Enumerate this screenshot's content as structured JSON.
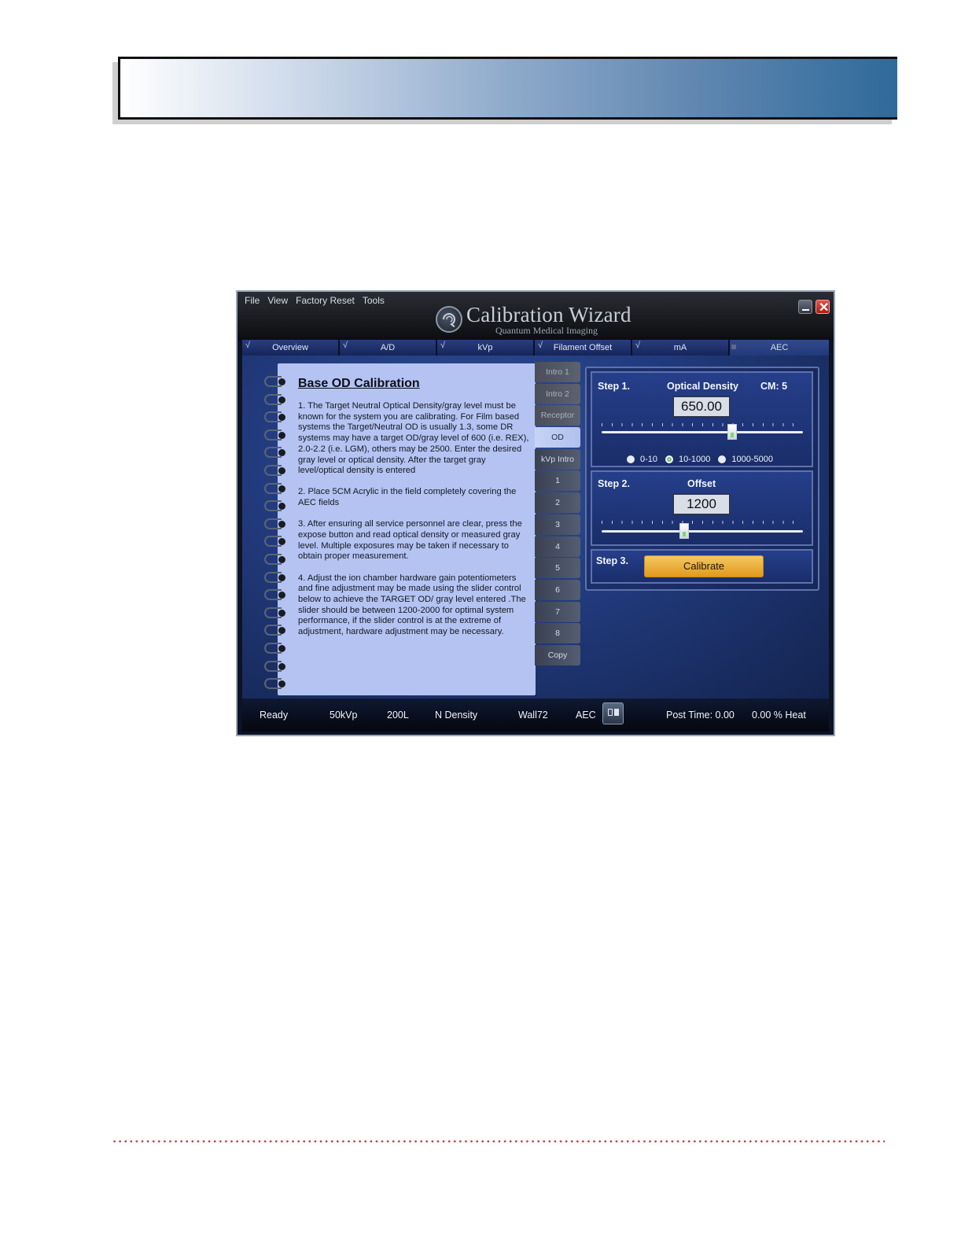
{
  "app": {
    "menu": [
      "File",
      "View",
      "Factory Reset",
      "Tools"
    ],
    "title": "Calibration Wizard",
    "subtitle": "Quantum Medical Imaging",
    "close_glyph": "✕"
  },
  "tabs": [
    {
      "label": "Overview",
      "checked": true
    },
    {
      "label": "A/D",
      "checked": true
    },
    {
      "label": "kVp",
      "checked": true
    },
    {
      "label": "Filament Offset",
      "checked": true
    },
    {
      "label": "mA",
      "checked": true
    },
    {
      "label": "AEC",
      "checked": false,
      "active": true
    }
  ],
  "check_glyph": "√",
  "notebook": {
    "title": "Base OD Calibration",
    "paragraphs": [
      "1. The Target Neutral Optical Density/gray level must be known for the system you are calibrating. For Film based systems the Target/Neutral OD is usually 1.3, some DR systems may have a target OD/gray level of 600 (i.e. REX), 2.0-2.2 (i.e. LGM), others may be 2500. Enter the desired gray level or optical density. After the target gray level/optical density is entered",
      "2. Place 5CM Acrylic in the field completely covering the AEC fields",
      "3. After ensuring all service personnel are clear, press the expose button and read optical density or measured gray level. Multiple exposures may be taken if necessary to obtain proper measurement.",
      "4. Adjust the ion chamber hardware gain potentiometers and fine adjustment may be made using the slider control below to achieve the TARGET OD/ gray level entered .The slider should be between 1200-2000 for optimal system performance, if the slider control is at the extreme of adjustment, hardware adjustment may be necessary."
    ]
  },
  "side_tabs": [
    "Intro 1",
    "Intro 2",
    "Receptor",
    "OD",
    "kVp Intro",
    "1",
    "2",
    "3",
    "4",
    "5",
    "6",
    "7",
    "8",
    "Copy"
  ],
  "side_tab_active": "OD",
  "step1": {
    "label": "Step 1.",
    "field": "Optical Density",
    "cm": "CM: 5",
    "value": "650.00",
    "slider_fraction": 0.65,
    "ranges": [
      "0-10",
      "10-1000",
      "1000-5000"
    ],
    "selected_range": "10-1000"
  },
  "step2": {
    "label": "Step 2.",
    "field": "Offset",
    "value": "1200",
    "slider_fraction": 0.41
  },
  "step3": {
    "label": "Step 3.",
    "button": "Calibrate"
  },
  "status": {
    "state": "Ready",
    "kvp": "50kVp",
    "ma": "200L",
    "density": "N Density",
    "receptor": "Wall72",
    "mode": "AEC",
    "post_time": "Post Time: 0.00",
    "heat": "0.00 % Heat"
  },
  "colors": {
    "accent_button": "#e9a52a",
    "window_bg": "#223b7e",
    "notebook_bg": "#b4c3f2"
  }
}
